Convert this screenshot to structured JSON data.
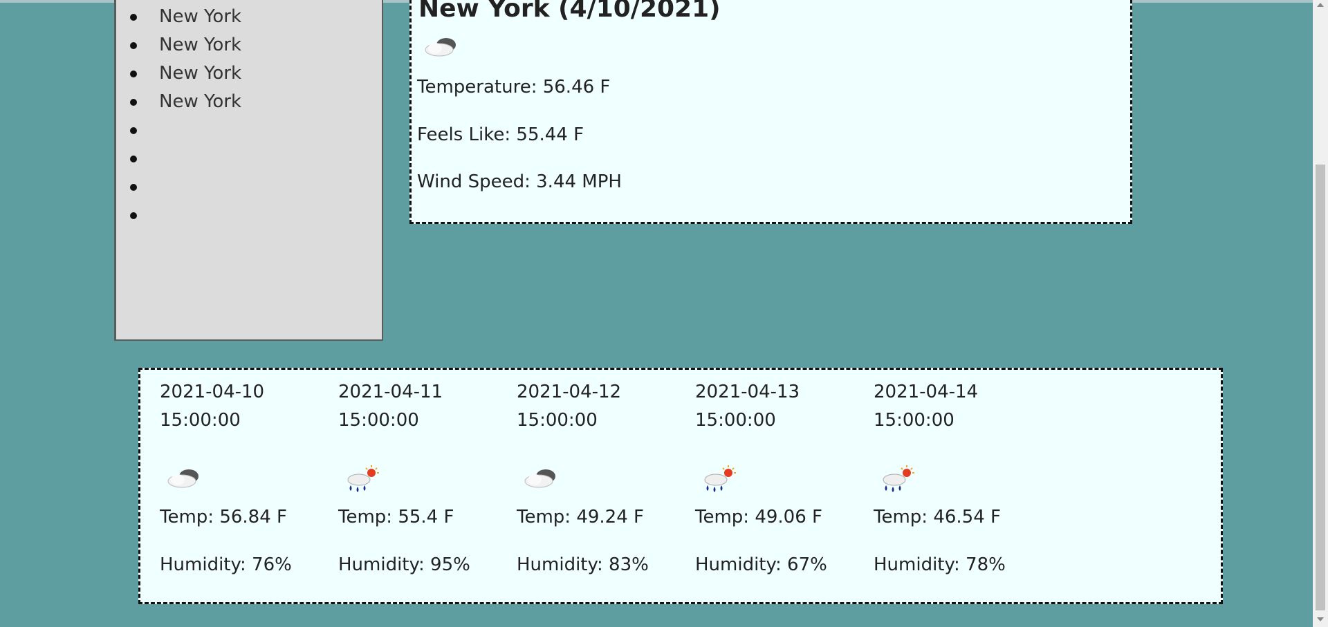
{
  "search_history": {
    "items": [
      "New York",
      "New York",
      "New York",
      "New York",
      "",
      "",
      "",
      ""
    ]
  },
  "current": {
    "title": "New York (4/10/2021)",
    "icon": "cloud-icon",
    "temperature": "Temperature: 56.46 F",
    "feels_like": "Feels Like: 55.44 F",
    "wind_speed": "Wind Speed: 3.44 MPH"
  },
  "forecast": [
    {
      "date": "2021-04-10",
      "time": "15:00:00",
      "icon": "cloud-icon",
      "temp": "Temp: 56.84 F",
      "humidity": "Humidity: 76%"
    },
    {
      "date": "2021-04-11",
      "time": "15:00:00",
      "icon": "rain-sun-icon",
      "temp": "Temp: 55.4 F",
      "humidity": "Humidity: 95%"
    },
    {
      "date": "2021-04-12",
      "time": "15:00:00",
      "icon": "cloud-icon",
      "temp": "Temp: 49.24 F",
      "humidity": "Humidity: 83%"
    },
    {
      "date": "2021-04-13",
      "time": "15:00:00",
      "icon": "rain-sun-icon",
      "temp": "Temp: 49.06 F",
      "humidity": "Humidity: 67%"
    },
    {
      "date": "2021-04-14",
      "time": "15:00:00",
      "icon": "rain-sun-icon",
      "temp": "Temp: 46.54 F",
      "humidity": "Humidity: 78%"
    }
  ],
  "colors": {
    "page_background": "#5f9ea0",
    "card_background": "#f0ffff",
    "sidebar_background": "#dcdcdc"
  }
}
